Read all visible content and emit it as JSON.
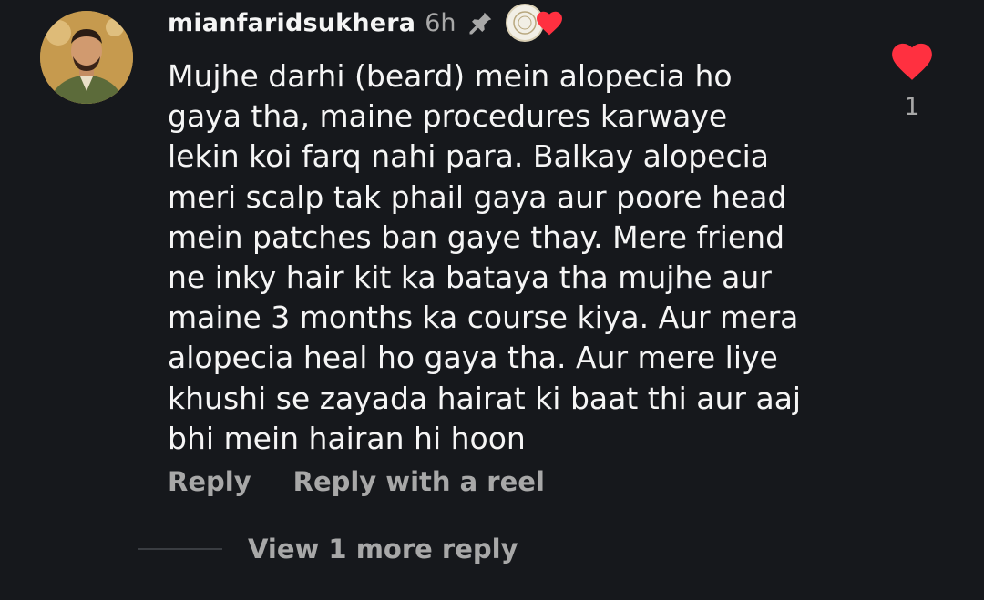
{
  "comment": {
    "username": "mianfaridsukhera",
    "time": "6h",
    "pinned": true,
    "creator_liked": true,
    "avatar_icon": "user-avatar",
    "text": "Mujhe darhi (beard) mein alopecia ho gaya tha, maine procedures karwaye lekin koi farq nahi para. Balkay alopecia meri scalp tak phail gaya aur poore head mein patches ban gaye thay. Mere friend ne inky hair kit ka bataya tha mujhe aur maine 3 months ka course kiya. Aur mera alopecia heal ho gaya tha. Aur mere liye khushi se zayada hairat ki baat thi aur aaj bhi mein hairan hi hoon",
    "lines": [
      "Mujhe darhi (beard) mein alopecia ho",
      "gaya tha, maine procedures karwaye",
      "lekin koi farq nahi para. Balkay alopecia",
      "meri scalp tak phail gaya aur poore head",
      "mein patches ban gaye thay. Mere friend",
      "ne inky hair kit ka bataya tha mujhe aur",
      "maine 3 months ka course kiya. Aur mera",
      "alopecia heal ho gaya tha. Aur mere liye",
      "khushi se zayada hairat ki baat thi aur aaj",
      "bhi mein hairan hi hoon"
    ],
    "like_count": "1"
  },
  "actions": {
    "reply_label": "Reply",
    "reply_reel_label": "Reply with a reel"
  },
  "replies": {
    "view_more_label": "View 1 more reply"
  },
  "colors": {
    "background": "#16181c",
    "text_primary": "#f5f5f5",
    "text_secondary": "#a8a8a8",
    "like_red": "#ff3040"
  }
}
